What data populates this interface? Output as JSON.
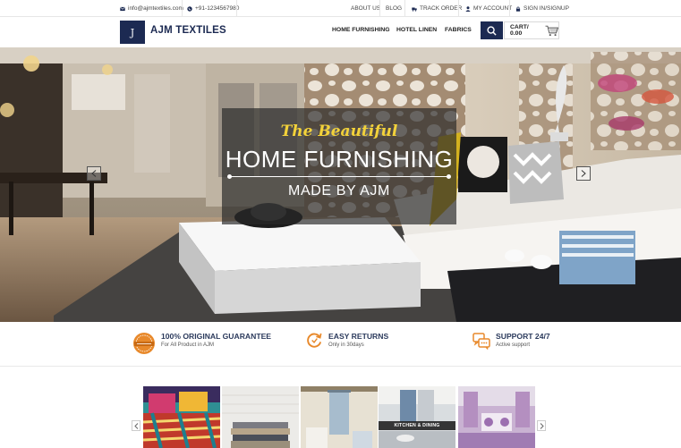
{
  "topbar": {
    "email": "info@ajmtextiles.com",
    "phone": "+91-1234567980",
    "about_us": "ABOUT US",
    "blog": "BLOG",
    "track_order": "TRACK ORDER",
    "my_account": "MY ACCOUNT",
    "sign_in": "SIGN IN/SIGNUP"
  },
  "header": {
    "logo_mark": "J",
    "logo_text": "AJM TEXTILES",
    "nav": [
      "HOME FURNISHING",
      "HOTEL LINEN",
      "FABRICS"
    ],
    "cart_label": "CART/ 0.00"
  },
  "hero": {
    "tagline": "The Beautiful",
    "title": "HOME FURNISHING",
    "subtitle": "MADE BY AJM"
  },
  "features": [
    {
      "title": "100% ORIGINAL GUARANTEE",
      "subtitle": "For All Product in AJM",
      "icon": "original-seal-icon"
    },
    {
      "title": "EASY RETURNS",
      "subtitle": "Only in 30days",
      "icon": "returns-icon"
    },
    {
      "title": "SUPPORT 24/7",
      "subtitle": "Active support",
      "icon": "support-chat-icon"
    }
  ],
  "categories": {
    "active_label": "KITCHEN & DINING"
  },
  "colors": {
    "brand_navy": "#1c2a52",
    "accent_yellow": "#f3d23a",
    "feature_orange": "#e8892b"
  }
}
